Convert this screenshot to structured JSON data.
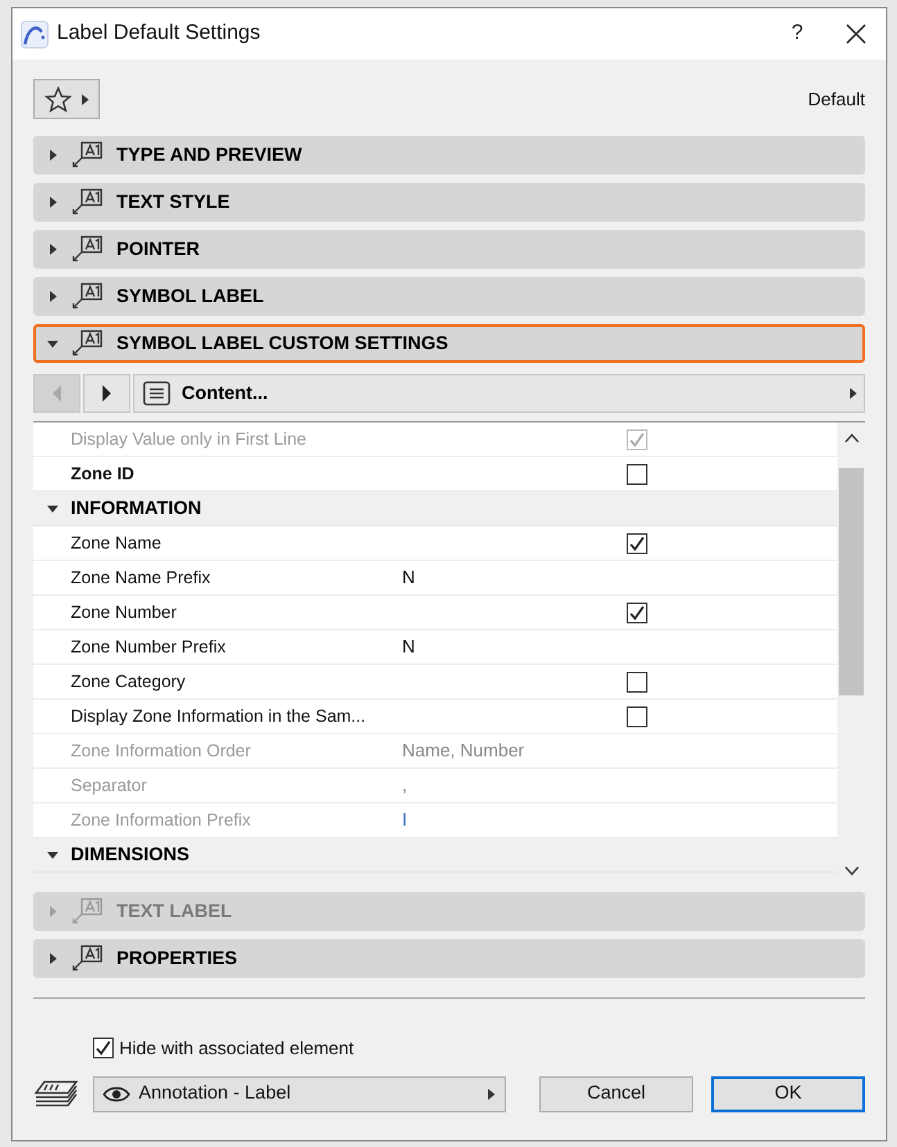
{
  "window": {
    "title": "Label Default Settings",
    "help": "?"
  },
  "favorites": {
    "label": "Default"
  },
  "panels_top": [
    {
      "title": "TYPE AND PREVIEW",
      "expanded": false,
      "disabled": false,
      "selected": false
    },
    {
      "title": "TEXT STYLE",
      "expanded": false,
      "disabled": false,
      "selected": false
    },
    {
      "title": "POINTER",
      "expanded": false,
      "disabled": false,
      "selected": false
    },
    {
      "title": "SYMBOL LABEL",
      "expanded": false,
      "disabled": false,
      "selected": false
    },
    {
      "title": "SYMBOL LABEL CUSTOM SETTINGS",
      "expanded": true,
      "disabled": false,
      "selected": true
    }
  ],
  "content_nav": {
    "page": "Content...",
    "back_disabled": true
  },
  "settings": [
    {
      "kind": "check",
      "label": "Display Value only in First Line",
      "bold": false,
      "disabled": true,
      "checked": true
    },
    {
      "kind": "check",
      "label": "Zone ID",
      "bold": true,
      "disabled": false,
      "checked": false
    },
    {
      "kind": "group",
      "label": "INFORMATION",
      "expanded": true
    },
    {
      "kind": "check",
      "label": "Zone Name",
      "bold": false,
      "disabled": false,
      "checked": true
    },
    {
      "kind": "text",
      "label": "Zone Name Prefix",
      "bold": false,
      "disabled": false,
      "value": "N"
    },
    {
      "kind": "check",
      "label": "Zone Number",
      "bold": false,
      "disabled": false,
      "checked": true
    },
    {
      "kind": "text",
      "label": "Zone Number Prefix",
      "bold": false,
      "disabled": false,
      "value": "N"
    },
    {
      "kind": "check",
      "label": "Zone Category",
      "bold": false,
      "disabled": false,
      "checked": false
    },
    {
      "kind": "check",
      "label": "Display Zone Information in the Sam...",
      "bold": false,
      "disabled": false,
      "checked": false
    },
    {
      "kind": "text",
      "label": "Zone Information Order",
      "bold": false,
      "disabled": true,
      "value": "Name, Number"
    },
    {
      "kind": "text",
      "label": "Separator",
      "bold": false,
      "disabled": true,
      "value": ","
    },
    {
      "kind": "text",
      "label": "Zone Information Prefix",
      "bold": false,
      "disabled": true,
      "value": "I"
    },
    {
      "kind": "group",
      "label": "DIMENSIONS",
      "expanded": true
    }
  ],
  "panels_bottom": [
    {
      "title": "TEXT LABEL",
      "expanded": false,
      "disabled": true,
      "selected": false
    },
    {
      "title": "PROPERTIES",
      "expanded": false,
      "disabled": false,
      "selected": false
    }
  ],
  "hide_with_element": {
    "label": "Hide with associated element",
    "checked": true
  },
  "layer": {
    "label": "Annotation - Label"
  },
  "buttons": [
    {
      "label": "Cancel",
      "default": false
    },
    {
      "label": "OK",
      "default": true
    }
  ]
}
